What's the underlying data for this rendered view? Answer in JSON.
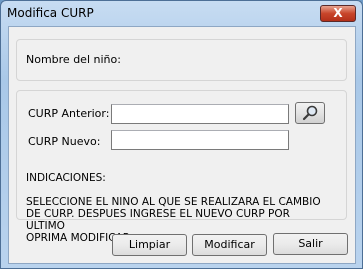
{
  "window": {
    "title": "Modifica CURP",
    "close_symbol": "X"
  },
  "child_panel": {
    "label": "Nombre del niño:"
  },
  "curp_panel": {
    "previous_label": "CURP Anterior:",
    "previous_value": "",
    "search_icon": "magnifier-icon",
    "new_label": "CURP Nuevo:",
    "new_value": "",
    "instructions_title": "INDICACIONES:",
    "instructions_text": "SELECCIONE EL NINO AL QUE SE REALIZARA EL CAMBIO\nDE CURP. DESPUES INGRESE EL NUEVO CURP POR ULTIMO\nOPRIMA MODIFICAR."
  },
  "buttons": {
    "clear": "Limpiar",
    "modify": "Modificar",
    "exit": "Salir"
  }
}
